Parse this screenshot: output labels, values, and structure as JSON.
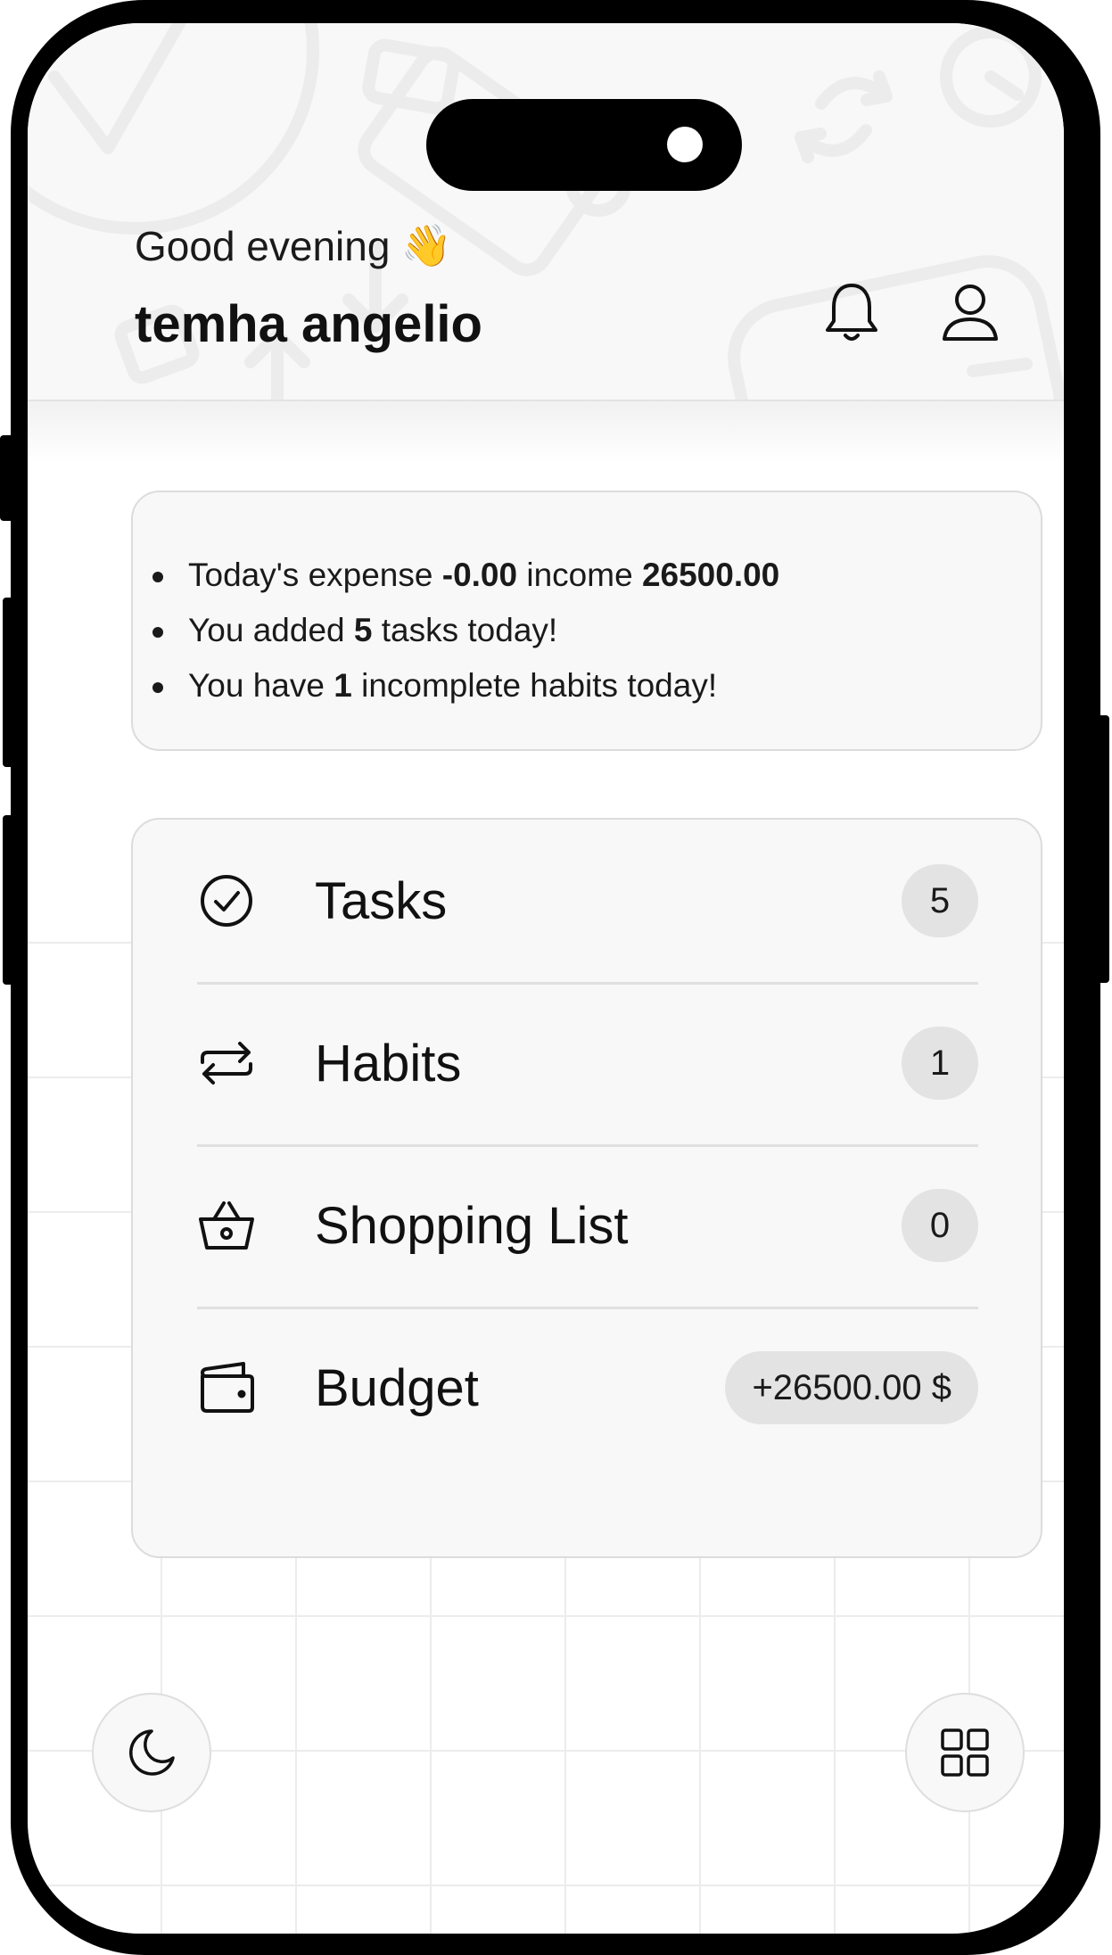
{
  "header": {
    "greeting": "Good evening",
    "greeting_emoji": "👋",
    "username": "temha angelio",
    "icons": [
      "bell-icon",
      "user-icon"
    ]
  },
  "summary": {
    "line1": {
      "pre": "Today's expense ",
      "expense": "-0.00",
      "mid": " income ",
      "income": "26500.00"
    },
    "line2": {
      "pre": "You added ",
      "count": "5",
      "post": " tasks today!"
    },
    "line3": {
      "pre": "You have ",
      "count": "1",
      "post": " incomplete habits today!"
    }
  },
  "menu": {
    "items": [
      {
        "label": "Tasks",
        "badge": "5",
        "icon": "check-circle-icon"
      },
      {
        "label": "Habits",
        "badge": "1",
        "icon": "repeat-icon"
      },
      {
        "label": "Shopping List",
        "badge": "0",
        "icon": "basket-icon"
      },
      {
        "label": "Budget",
        "badge": "+26500.00 $",
        "icon": "wallet-icon"
      }
    ]
  },
  "footer": {
    "left_icon": "moon-icon",
    "right_icon": "grid-icon"
  },
  "colors": {
    "background": "#ffffff",
    "card": "#f8f8f8",
    "badge": "#e3e3e3",
    "text": "#111111"
  }
}
